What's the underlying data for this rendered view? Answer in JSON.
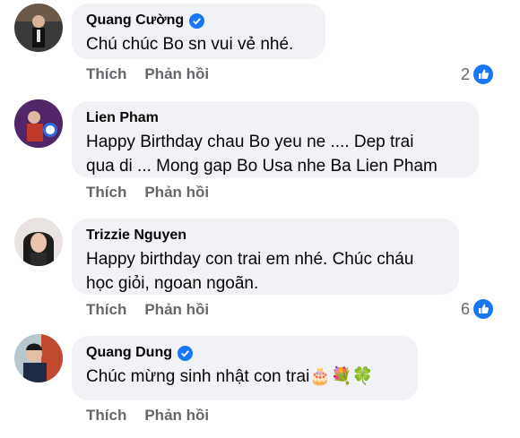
{
  "comments": [
    {
      "name": "Quang Cường",
      "verified": true,
      "text_lines": [
        "Chú chúc Bo sn vui vẻ nhé."
      ],
      "like_label": "Thích",
      "reply_label": "Phản hồi",
      "reaction_count": "2"
    },
    {
      "name": "Lien Pham",
      "verified": false,
      "text_lines": [
        "Happy Birthday chau Bo yeu ne .... Dep trai",
        "qua di ... Mong gap Bo Usa nhe Ba Lien Pham"
      ],
      "like_label": "Thích",
      "reply_label": "Phản hồi",
      "reaction_count": ""
    },
    {
      "name": "Trizzie Nguyen",
      "verified": false,
      "text_lines": [
        "Happy birthday con trai em nhé. Chúc cháu",
        "học giỏi, ngoan ngoãn."
      ],
      "like_label": "Thích",
      "reply_label": "Phản hồi",
      "reaction_count": "6"
    },
    {
      "name": "Quang Dung",
      "verified": true,
      "text_lines": [
        "Chúc mừng sinh nhật con trai🎂💐🍀"
      ],
      "like_label": "Thích",
      "reply_label": "Phản hồi",
      "reaction_count": ""
    }
  ],
  "colors": {
    "bubble": "#f0f2f5",
    "secondary_text": "#65676b",
    "facebook_blue": "#1877f2"
  },
  "icons": [
    "verified-badge-icon",
    "like-reaction-icon"
  ]
}
